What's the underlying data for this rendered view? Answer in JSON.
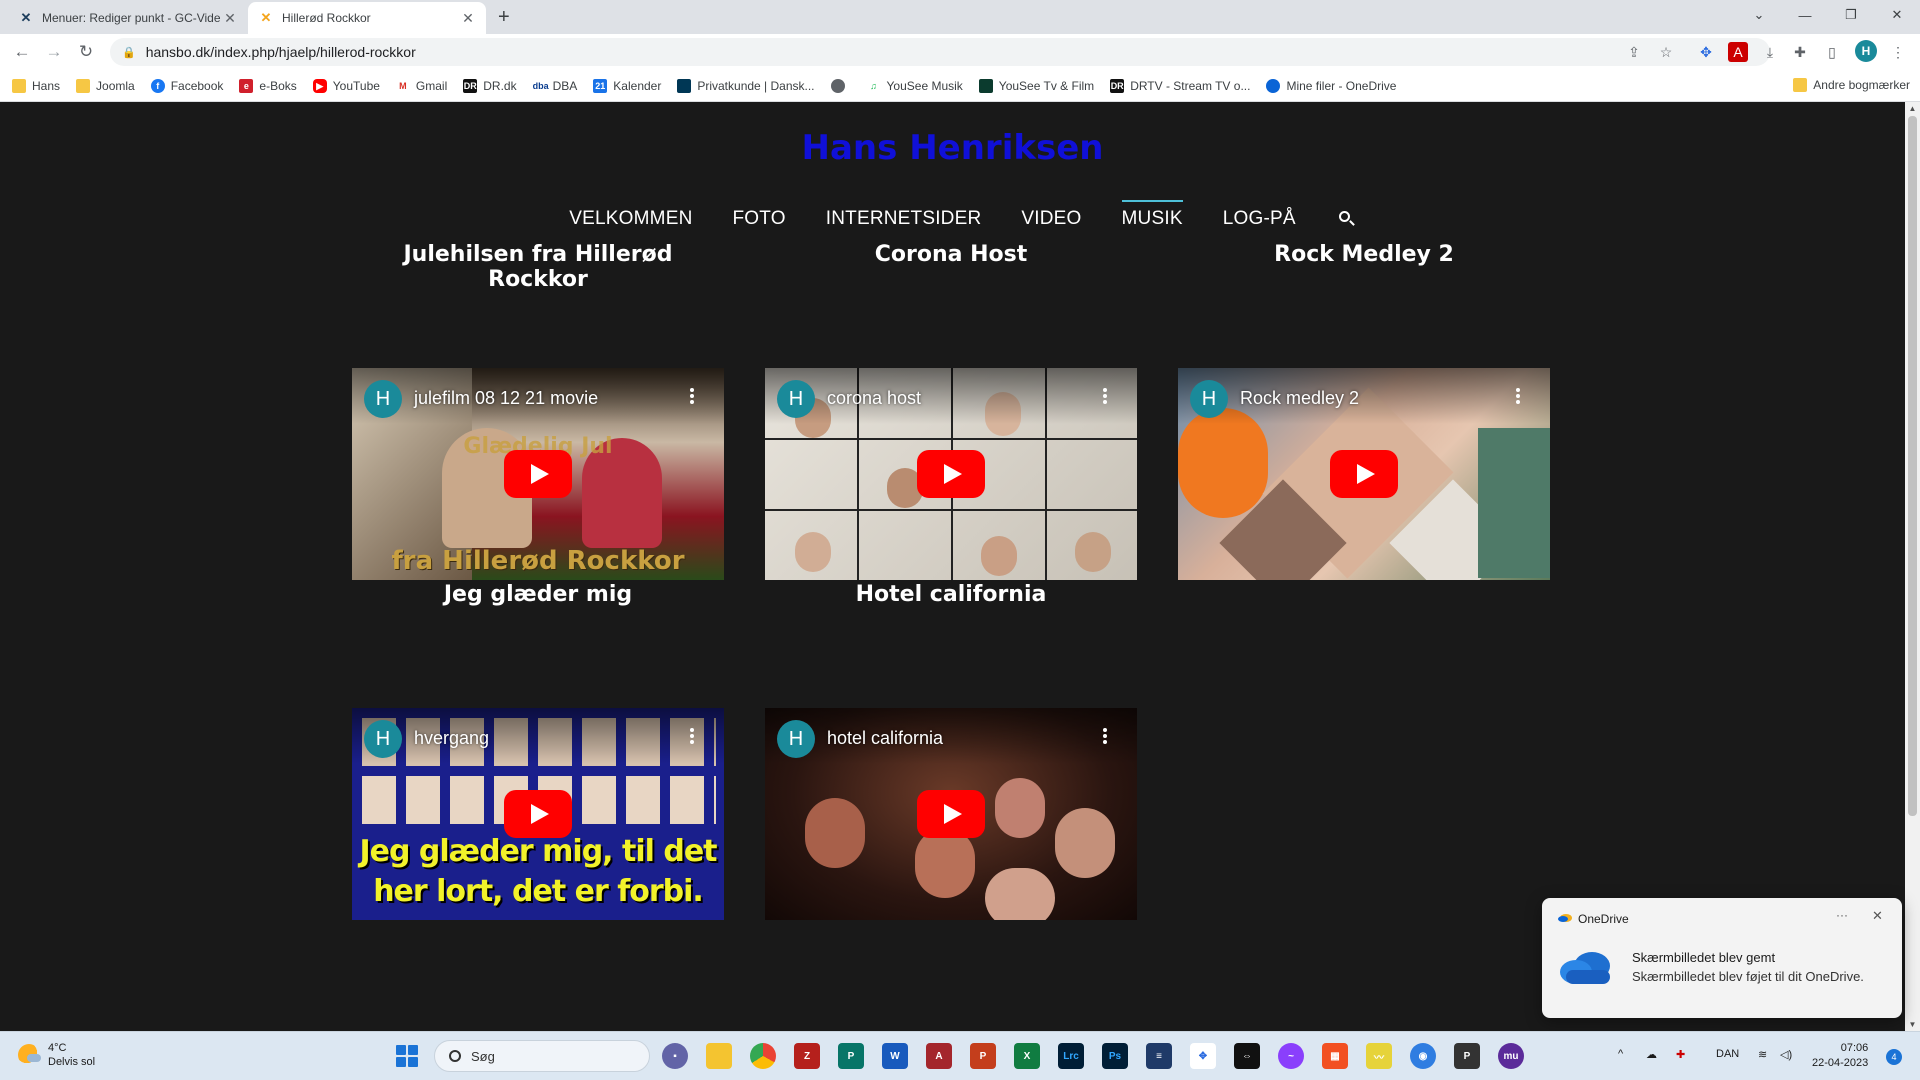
{
  "browser": {
    "tabs": [
      {
        "title": "Menuer: Rediger punkt - GC-Vide",
        "icon": "joomla-icon"
      },
      {
        "title": "Hillerød Rockkor",
        "icon": "joomla-icon"
      }
    ],
    "address": "hansbo.dk/index.php/hjaelp/hillerod-rockkor",
    "profile_initial": "H",
    "bookmarks": [
      {
        "label": "Hans",
        "icon": "folder-icon"
      },
      {
        "label": "Joomla",
        "icon": "folder-icon"
      },
      {
        "label": "Facebook",
        "icon": "facebook-icon"
      },
      {
        "label": "e-Boks",
        "icon": "eboks-icon"
      },
      {
        "label": "YouTube",
        "icon": "youtube-icon"
      },
      {
        "label": "Gmail",
        "icon": "gmail-icon"
      },
      {
        "label": "DR.dk",
        "icon": "dr-icon"
      },
      {
        "label": "DBA",
        "icon": "dba-icon"
      },
      {
        "label": "Kalender",
        "icon": "calendar-icon"
      },
      {
        "label": "Privatkunde | Dansk...",
        "icon": "bank-icon"
      },
      {
        "label": "",
        "icon": "globe-icon"
      },
      {
        "label": "YouSee Musik",
        "icon": "music-icon"
      },
      {
        "label": "YouSee Tv & Film",
        "icon": "tv-icon"
      },
      {
        "label": "DRTV - Stream TV o...",
        "icon": "drtv-icon"
      },
      {
        "label": "Mine filer - OneDrive",
        "icon": "onedrive-icon"
      }
    ],
    "other_bookmarks": "Andre bogmærker"
  },
  "site": {
    "title": "Hans Henriksen",
    "nav": [
      {
        "label": "VELKOMMEN",
        "active": false
      },
      {
        "label": "FOTO",
        "active": false
      },
      {
        "label": "INTERNETSIDER",
        "active": false
      },
      {
        "label": "VIDEO",
        "active": false
      },
      {
        "label": "MUSIK",
        "active": true
      },
      {
        "label": "LOG-PÅ",
        "active": false
      }
    ],
    "videos": [
      {
        "heading": "Julehilsen fra Hillerød Rockkor",
        "video_title": "julefilm 08 12 21 movie",
        "channel_initial": "H",
        "caption_top": "Glædelig Jul",
        "caption_bottom": "fra Hillerød Rockkor"
      },
      {
        "heading": "Corona Host",
        "video_title": "corona host",
        "channel_initial": "H"
      },
      {
        "heading": "Rock Medley 2",
        "video_title": "Rock medley 2",
        "channel_initial": "H"
      },
      {
        "heading": "Jeg glæder mig",
        "video_title": "hvergang",
        "channel_initial": "H",
        "caption_line1": "Jeg glæder mig, til det",
        "caption_line2": "her lort, det er forbi."
      },
      {
        "heading": "Hotel california",
        "video_title": "hotel california",
        "channel_initial": "H"
      }
    ]
  },
  "toast": {
    "app": "OneDrive",
    "title": "Skærmbilledet blev gemt",
    "body": "Skærmbilledet blev føjet til dit OneDrive."
  },
  "taskbar": {
    "temperature": "4°C",
    "weather": "Delvis sol",
    "search_placeholder": "Søg",
    "language": "DAN",
    "time": "07:06",
    "date": "22-04-2023",
    "notification_count": "4"
  }
}
